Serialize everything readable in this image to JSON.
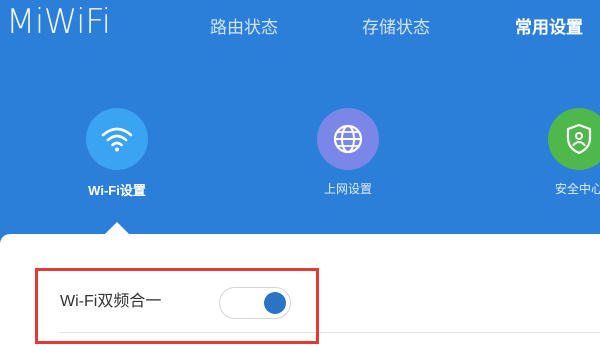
{
  "header": {
    "logo": "MiWiFi",
    "nav": [
      {
        "label": "路由状态"
      },
      {
        "label": "存储状态"
      },
      {
        "label": "常用设置"
      }
    ]
  },
  "features": [
    {
      "label": "Wi-Fi设置",
      "icon": "wifi-icon",
      "color": "#3aa3f2"
    },
    {
      "label": "上网设置",
      "icon": "globe-icon",
      "color": "#7b87e8"
    },
    {
      "label": "安全中心",
      "icon": "shield-icon",
      "color": "#4fb84d"
    }
  ],
  "settings": {
    "dual_band_label": "Wi-Fi双频合一",
    "dual_band_enabled": true
  },
  "colors": {
    "header_bg": "#2c7fd9",
    "highlight": "#e53935",
    "toggle_knob": "#2a73c5"
  }
}
